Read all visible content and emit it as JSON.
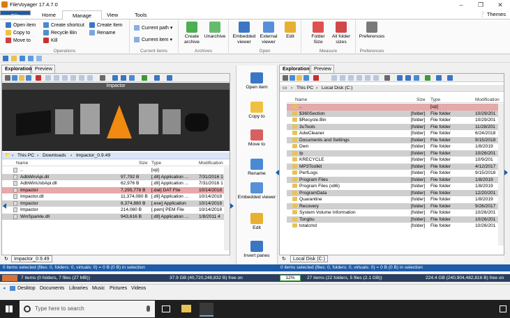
{
  "window": {
    "title": "FileVoyager 17.4.7.0",
    "themes": "Themes"
  },
  "tabs": [
    "File",
    "Home",
    "Manage",
    "View",
    "Tools"
  ],
  "ribbon": {
    "operations": {
      "label": "Operations",
      "items": [
        "Open item",
        "Copy to",
        "Move to",
        "Create shortcut",
        "Recycle Bin",
        "Kill",
        "Create Item",
        "Rename"
      ]
    },
    "current_items": {
      "label": "Current items",
      "items": [
        "Current path",
        "Current item"
      ]
    },
    "archives": {
      "label": "Archives",
      "items": [
        "Create archive",
        "Unarchive"
      ]
    },
    "open": {
      "label": "Open",
      "items": [
        "Embedded viewer",
        "External viewer",
        "Edit"
      ]
    },
    "measure": {
      "label": "Measure",
      "items": [
        "Folder Size",
        "All folder sizes"
      ]
    },
    "preferences": {
      "label": "Preferences",
      "items": [
        "Preferences"
      ]
    }
  },
  "left": {
    "tabs": [
      "Exploration",
      "Preview"
    ],
    "preview_title": "Impactor",
    "breadcrumb": [
      "This PC",
      "Downloads",
      "Impactor_0.9.49"
    ],
    "columns": [
      "Name",
      "Size",
      "Type",
      "Modification"
    ],
    "rows": [
      {
        "name": "..",
        "size": "",
        "type": "[up]",
        "mod": ""
      },
      {
        "name": "AdbWinApi.dll",
        "size": "97,792 B",
        "type": "[.dll] Application ...",
        "mod": "7/31/2016 1"
      },
      {
        "name": "AdbWinUsbApi.dll",
        "size": "62,976 B",
        "type": "[.dll] Application ...",
        "mod": "7/31/2016 1"
      },
      {
        "name": "Impactor",
        "size": "7,295,778 B",
        "type": "[.dat] DAT File",
        "mod": "10/14/2018"
      },
      {
        "name": "Impactor.dll",
        "size": "11,374,080 B",
        "type": "[.dll] Application ...",
        "mod": "10/14/2018"
      },
      {
        "name": "Impactor",
        "size": "8,374,880 B",
        "type": "[.exe] Application",
        "mod": "10/14/2018"
      },
      {
        "name": "Impactor",
        "size": "214,060 B",
        "type": "[.pem] PEM File",
        "mod": "10/14/2018"
      },
      {
        "name": "WinSparkle.dll",
        "size": "943,616 B",
        "type": "[.dll] Application ...",
        "mod": "1/8/2011 4"
      }
    ],
    "footer_tab": "Impactor_0.9.49",
    "status": "0 items selected (files: 0, folders: 0, virtuals: 0) = 0 B (0 B) in selection",
    "summary": "7 items (0 folders, 7 files (27 MB))",
    "drive": "37.9 GB (40,720,248,832 B) free on"
  },
  "middle": [
    "Open item",
    "Copy to",
    "Move to",
    "Rename",
    "Embedded viewer",
    "Edit",
    "Invert panes"
  ],
  "right": {
    "tabs": [
      "Exploration",
      "Preview"
    ],
    "breadcrumb": [
      "This PC",
      "Local Disk (C:)"
    ],
    "columns": [
      "Name",
      "Size",
      "Type",
      "Modification"
    ],
    "rows": [
      {
        "name": "..",
        "size": "",
        "type": "[up]",
        "mod": ""
      },
      {
        "name": "$360Section",
        "size": "[folder]",
        "type": "File folder",
        "mod": "10/29/201"
      },
      {
        "name": "$Recycle.Bin",
        "size": "[folder]",
        "type": "File folder",
        "mod": "10/29/201"
      },
      {
        "name": "3uTools",
        "size": "[folder]",
        "type": "File folder",
        "mod": "11/28/201"
      },
      {
        "name": "AdwCleaner",
        "size": "[folder]",
        "type": "File folder",
        "mod": "6/24/2018"
      },
      {
        "name": "Documents and Settings",
        "size": "[folder]",
        "type": "File folder",
        "mod": "9/15/2018"
      },
      {
        "name": "Dwn",
        "size": "[folder]",
        "type": "File folder",
        "mod": "1/8/2019"
      },
      {
        "name": "Ip",
        "size": "[folder]",
        "type": "File folder",
        "mod": "10/26/201"
      },
      {
        "name": "KRECYCLE",
        "size": "[folder]",
        "type": "File folder",
        "mod": "10/9/201"
      },
      {
        "name": "MP3Toolkit",
        "size": "[folder]",
        "type": "File folder",
        "mod": "4/12/2017"
      },
      {
        "name": "PerfLogs",
        "size": "[folder]",
        "type": "File folder",
        "mod": "9/15/2018"
      },
      {
        "name": "Program Files",
        "size": "[folder]",
        "type": "File folder",
        "mod": "1/8/2019"
      },
      {
        "name": "Program Files (x86)",
        "size": "[folder]",
        "type": "File folder",
        "mod": "1/8/2019"
      },
      {
        "name": "ProgramData",
        "size": "[folder]",
        "type": "File folder",
        "mod": "12/20/201"
      },
      {
        "name": "Quarantine",
        "size": "[folder]",
        "type": "File folder",
        "mod": "1/8/2019"
      },
      {
        "name": "Recovery",
        "size": "[folder]",
        "type": "File folder",
        "mod": "9/26/2017"
      },
      {
        "name": "System Volume Information",
        "size": "[folder]",
        "type": "File folder",
        "mod": "10/26/201"
      },
      {
        "name": "Tongbu",
        "size": "[folder]",
        "type": "File folder",
        "mod": "10/26/201"
      },
      {
        "name": "totalcmd",
        "size": "[folder]",
        "type": "File folder",
        "mod": "10/26/201"
      }
    ],
    "footer_tab": "Local Disk (C:)",
    "status": "0 items selected (files: 0, folders: 0, virtuals: 0) = 0 B (0 B) in selection",
    "disk_percent": "12%",
    "summary": "27 items (22 folders, 5 files (2.1 GB))",
    "drive": "224.4 GB (240,904,482,816 B) free on"
  },
  "favorites": [
    "Desktop",
    "Documents",
    "Libraries",
    "Music",
    "Pictures",
    "Videos"
  ],
  "taskbar": {
    "search_placeholder": "Type here to search"
  },
  "colors": {
    "accent": "#1e5ba8",
    "selected_row": "#e6a8a8",
    "alt_row": "#cfcfcf"
  }
}
